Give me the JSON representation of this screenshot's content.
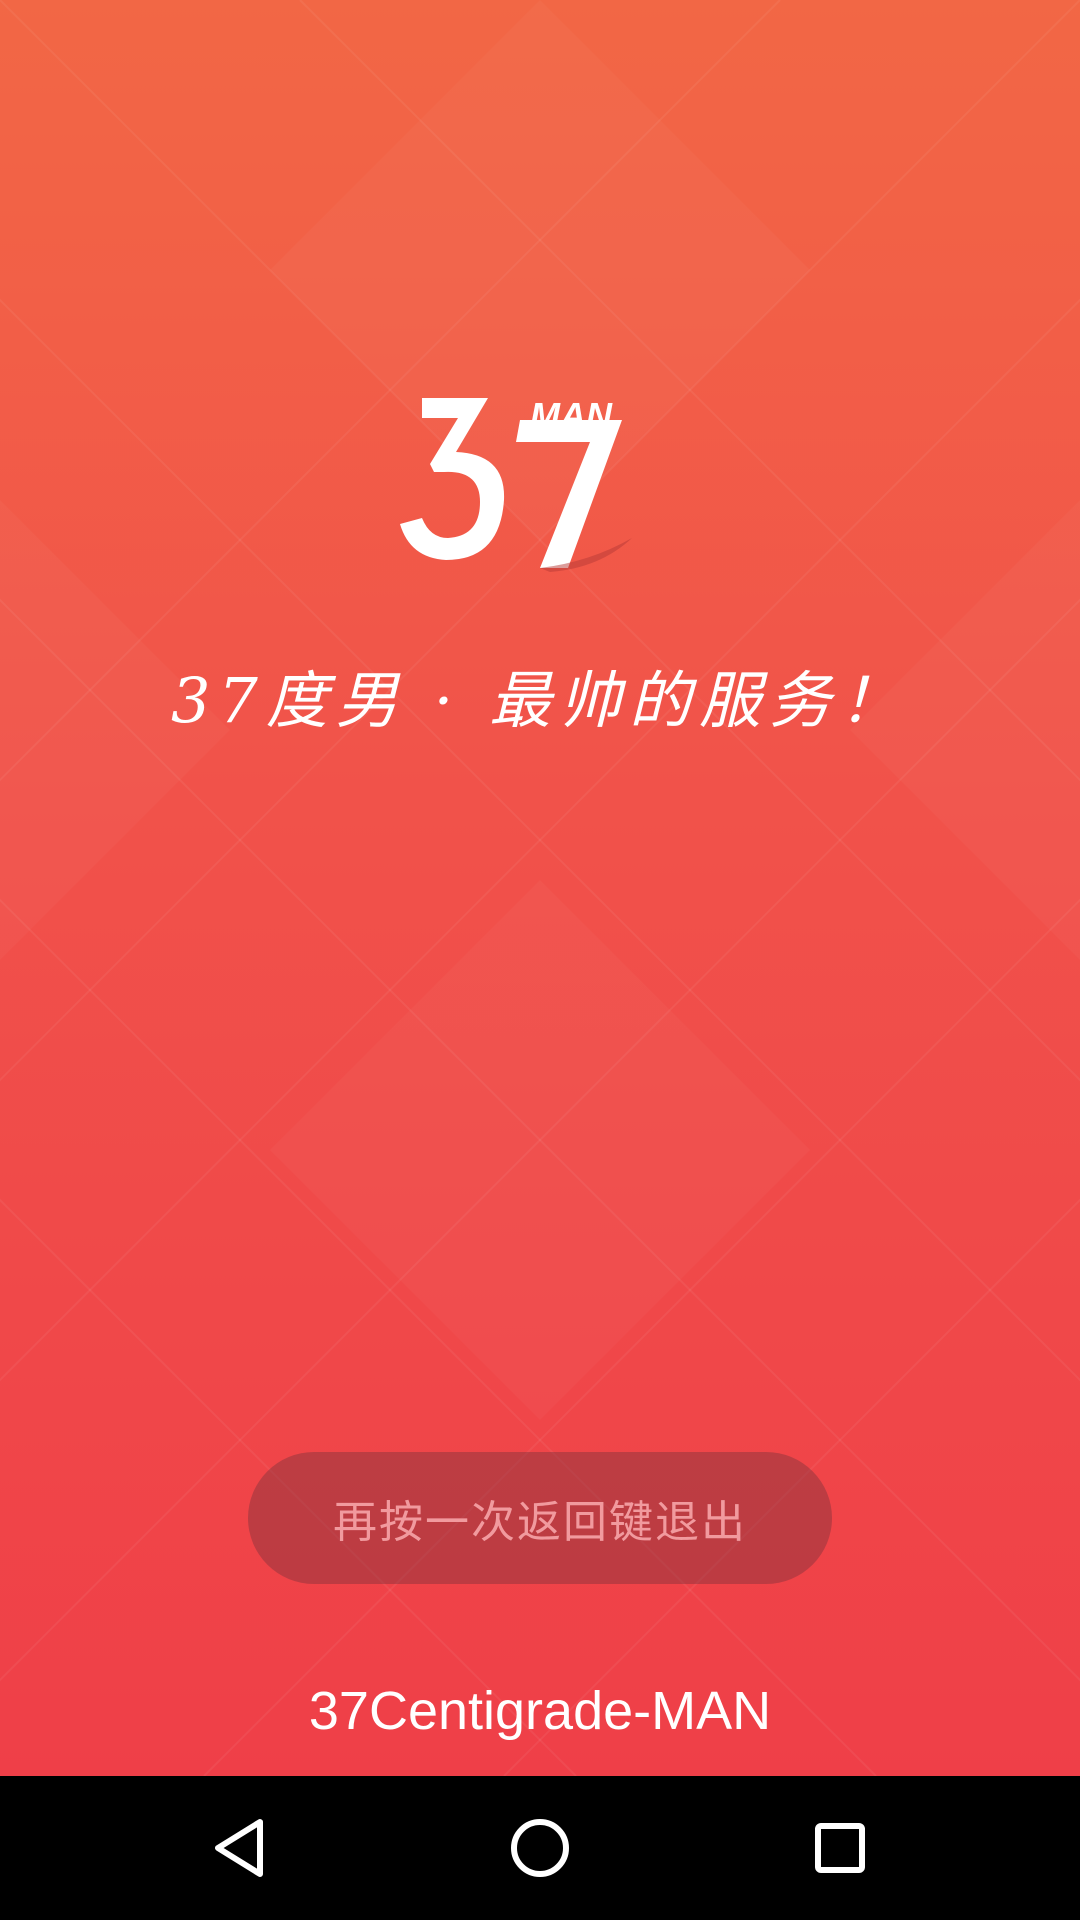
{
  "app": {
    "logo_text": "37MAN",
    "slogan": "37度男 · 最帅的服务！",
    "footer_brand": "37Centigrade-MAN"
  },
  "toast": {
    "message": "再按一次返回键退出"
  },
  "navbar": {
    "back_icon": "back-triangle-icon",
    "home_icon": "home-circle-icon",
    "recents_icon": "recents-square-icon"
  },
  "colors": {
    "background_top": "#f26745",
    "background_bottom": "#ef3f48",
    "toast_bg": "#7a323c",
    "toast_text": "#f19a9e",
    "navbar": "#000000",
    "text": "#ffffff"
  }
}
